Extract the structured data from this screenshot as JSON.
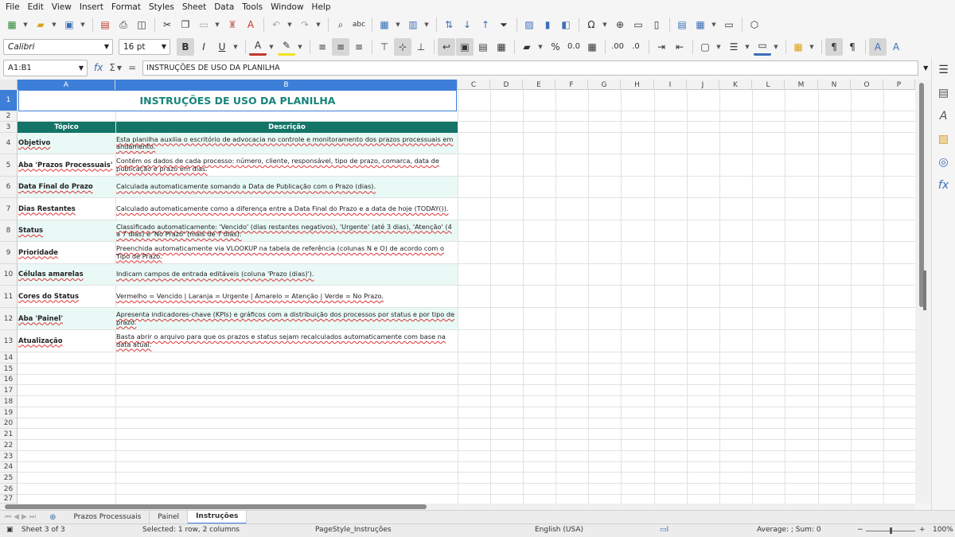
{
  "menu": [
    "File",
    "Edit",
    "View",
    "Insert",
    "Format",
    "Styles",
    "Sheet",
    "Data",
    "Tools",
    "Window",
    "Help"
  ],
  "toolbar2": {
    "font_name": "Calibri",
    "font_size": "16 pt"
  },
  "formula_bar": {
    "name_box": "A1:B1",
    "content": "INSTRUÇÕES DE USO DA PLANILHA"
  },
  "columns": [
    "A",
    "B",
    "C",
    "D",
    "E",
    "F",
    "G",
    "H",
    "I",
    "J",
    "K",
    "L",
    "M",
    "N",
    "O",
    "P"
  ],
  "rows": [
    "1",
    "2",
    "3",
    "4",
    "5",
    "6",
    "7",
    "8",
    "9",
    "10",
    "11",
    "12",
    "13",
    "14",
    "15",
    "16",
    "17",
    "18",
    "19",
    "20",
    "21",
    "22",
    "23",
    "24",
    "25",
    "26",
    "27"
  ],
  "sheet": {
    "title": "INSTRUÇÕES DE USO DA PLANILHA",
    "header_topic": "Tópico",
    "header_description": "Descrição",
    "rows": [
      {
        "topic": "Objetivo",
        "desc": "Esta planilha auxilia o escritório de advocacia no controle e monitoramento dos prazos processuais em andamento."
      },
      {
        "topic": "Aba 'Prazos Processuais'",
        "desc": "Contém os dados de cada processo: número, cliente, responsável, tipo de prazo, comarca, data de publicação e prazo em dias."
      },
      {
        "topic": "Data Final do Prazo",
        "desc": "Calculada automaticamente somando a Data de Publicação com o Prazo (dias)."
      },
      {
        "topic": "Dias Restantes",
        "desc": "Calculado automaticamente como a diferença entre a Data Final do Prazo e a data de hoje (TODAY())."
      },
      {
        "topic": "Status",
        "desc": "Classificado automaticamente: 'Vencido' (dias restantes negativos), 'Urgente' (até 3 dias), 'Atenção' (4 a 7 dias) e 'No Prazo' (mais de 7 dias)."
      },
      {
        "topic": "Prioridade",
        "desc": "Preenchida automaticamente via VLOOKUP na tabela de referência (colunas N e O) de acordo com o Tipo de Prazo."
      },
      {
        "topic": "Células amarelas",
        "desc": "Indicam campos de entrada editáveis (coluna 'Prazo (dias)')."
      },
      {
        "topic": "Cores do Status",
        "desc": "Vermelho = Vencido | Laranja = Urgente | Amarelo = Atenção | Verde = No Prazo."
      },
      {
        "topic": "Aba 'Painel'",
        "desc": "Apresenta indicadores-chave (KPIs) e gráficos com a distribuição dos processos por status e por tipo de prazo."
      },
      {
        "topic": "Atualização",
        "desc": "Basta abrir o arquivo para que os prazos e status sejam recalculados automaticamente com base na data atual."
      }
    ]
  },
  "tabs": [
    "Prazos Processuais",
    "Painel",
    "Instruções"
  ],
  "active_tab": "Instruções",
  "status": {
    "sheet": "Sheet 3 of 3",
    "selection": "Selected: 1 row, 2 columns",
    "page_style": "PageStyle_Instruções",
    "language": "English (USA)",
    "summary": "Average: ; Sum: 0",
    "zoom": "100%"
  },
  "colors": {
    "accent": "#3d7fd8",
    "header_bg": "#137467",
    "title_text": "#17847b",
    "row_shade": "#e9f9f6"
  }
}
